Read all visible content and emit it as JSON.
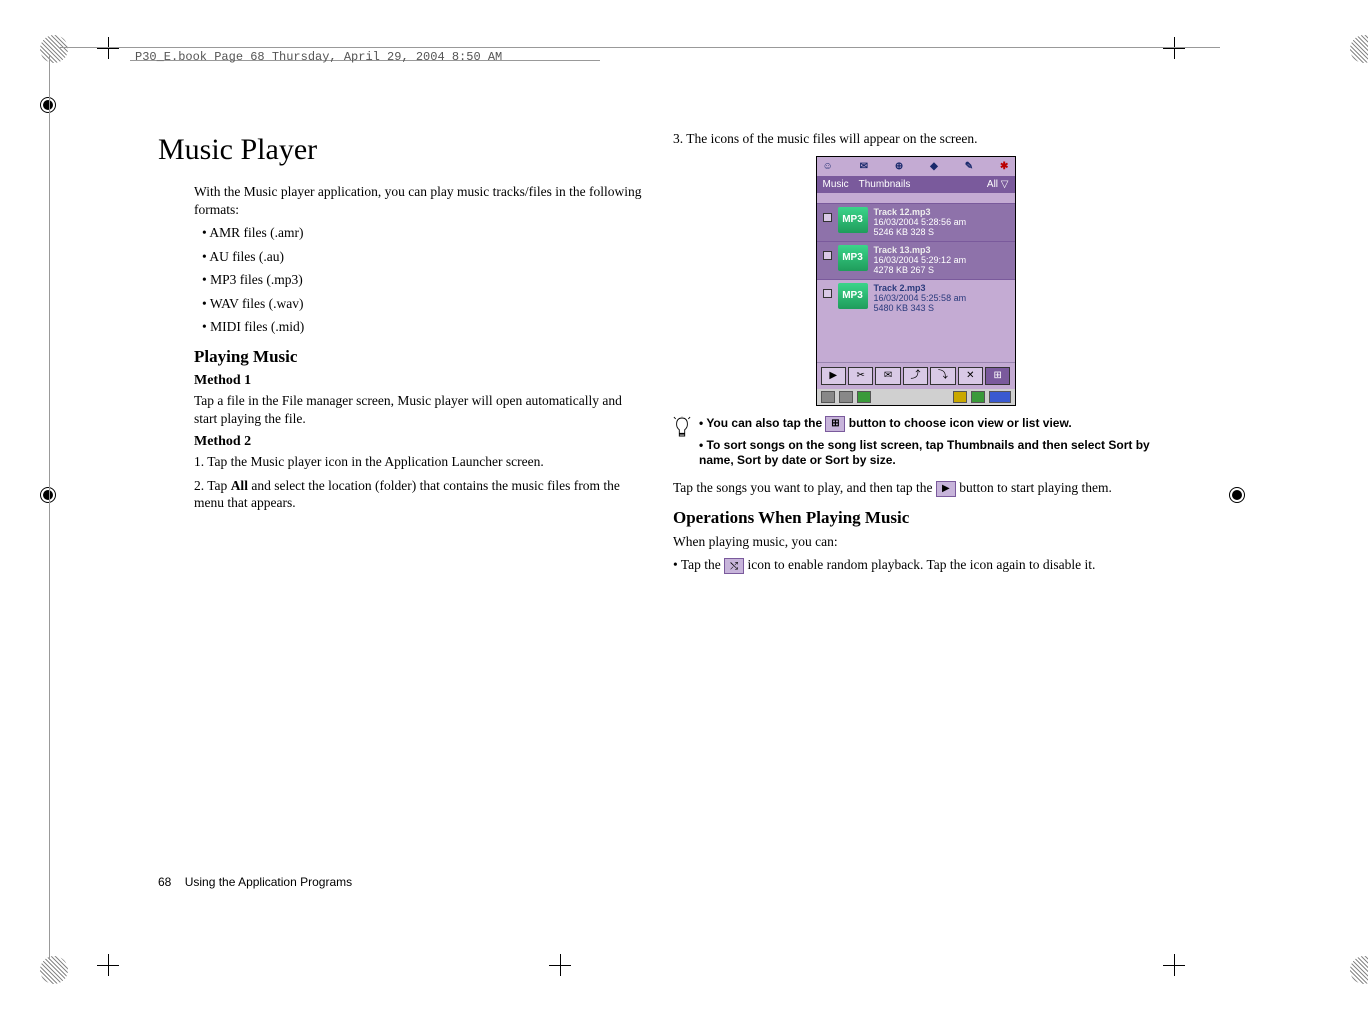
{
  "header": "P30_E.book  Page 68  Thursday, April 29, 2004  8:50 AM",
  "title": "Music Player",
  "left": {
    "intro": "With the Music player application, you can play music tracks/files in the following formats:",
    "formats": [
      "• AMR files (.amr)",
      "• AU files (.au)",
      "• MP3 files (.mp3)",
      "• WAV files (.wav)",
      "• MIDI files (.mid)"
    ],
    "h_playing": "Playing Music",
    "h_m1": "Method 1",
    "m1": "Tap a file in the File manager screen, Music player will open automatically and start playing the file.",
    "h_m2": "Method 2",
    "m2_1": "1. Tap the Music player icon in the Application Launcher screen.",
    "m2_2a": "2. Tap ",
    "m2_2b": "All",
    "m2_2c": " and select the location (folder) that contains the music files from the menu that appears."
  },
  "right": {
    "step3": "3. The icons of the music files will appear on the screen.",
    "phone": {
      "topbar": [
        "☺",
        "✉",
        "⊕",
        "◆",
        "✎",
        "✱"
      ],
      "row": {
        "left": "Music",
        "mid": "Thumbnails",
        "right": "All ▽"
      },
      "items": [
        {
          "title": "Track 12.mp3",
          "date": "16/03/2004 5:28:56 am",
          "size": "5246 KB  328 S"
        },
        {
          "title": "Track 13.mp3",
          "date": "16/03/2004 5:29:12 am",
          "size": "4278 KB  267 S"
        },
        {
          "title": "Track 2.mp3",
          "date": "16/03/2004 5:25:58 am",
          "size": "5480 KB  343 S"
        }
      ],
      "toolbar": [
        "▶",
        "✂",
        "✉",
        "⤴",
        "⤵",
        "✕",
        "⊞"
      ]
    },
    "tip1a": "• You can also tap the ",
    "tip1b": " button to choose icon view or list view.",
    "tip2": "• To sort songs on the song list screen, tap Thumbnails and then select Sort by name, Sort by date or Sort by size.",
    "play_a": "Tap the songs you want to play, and then tap the ",
    "play_b": " button to start playing them.",
    "h_ops": "Operations When Playing Music",
    "ops_intro": "When playing music, you can:",
    "op1_a": "• Tap the ",
    "op1_b": " icon to enable random playback. Tap the icon again to disable it."
  },
  "footer": {
    "page": "68",
    "section": "Using the Application Programs"
  }
}
